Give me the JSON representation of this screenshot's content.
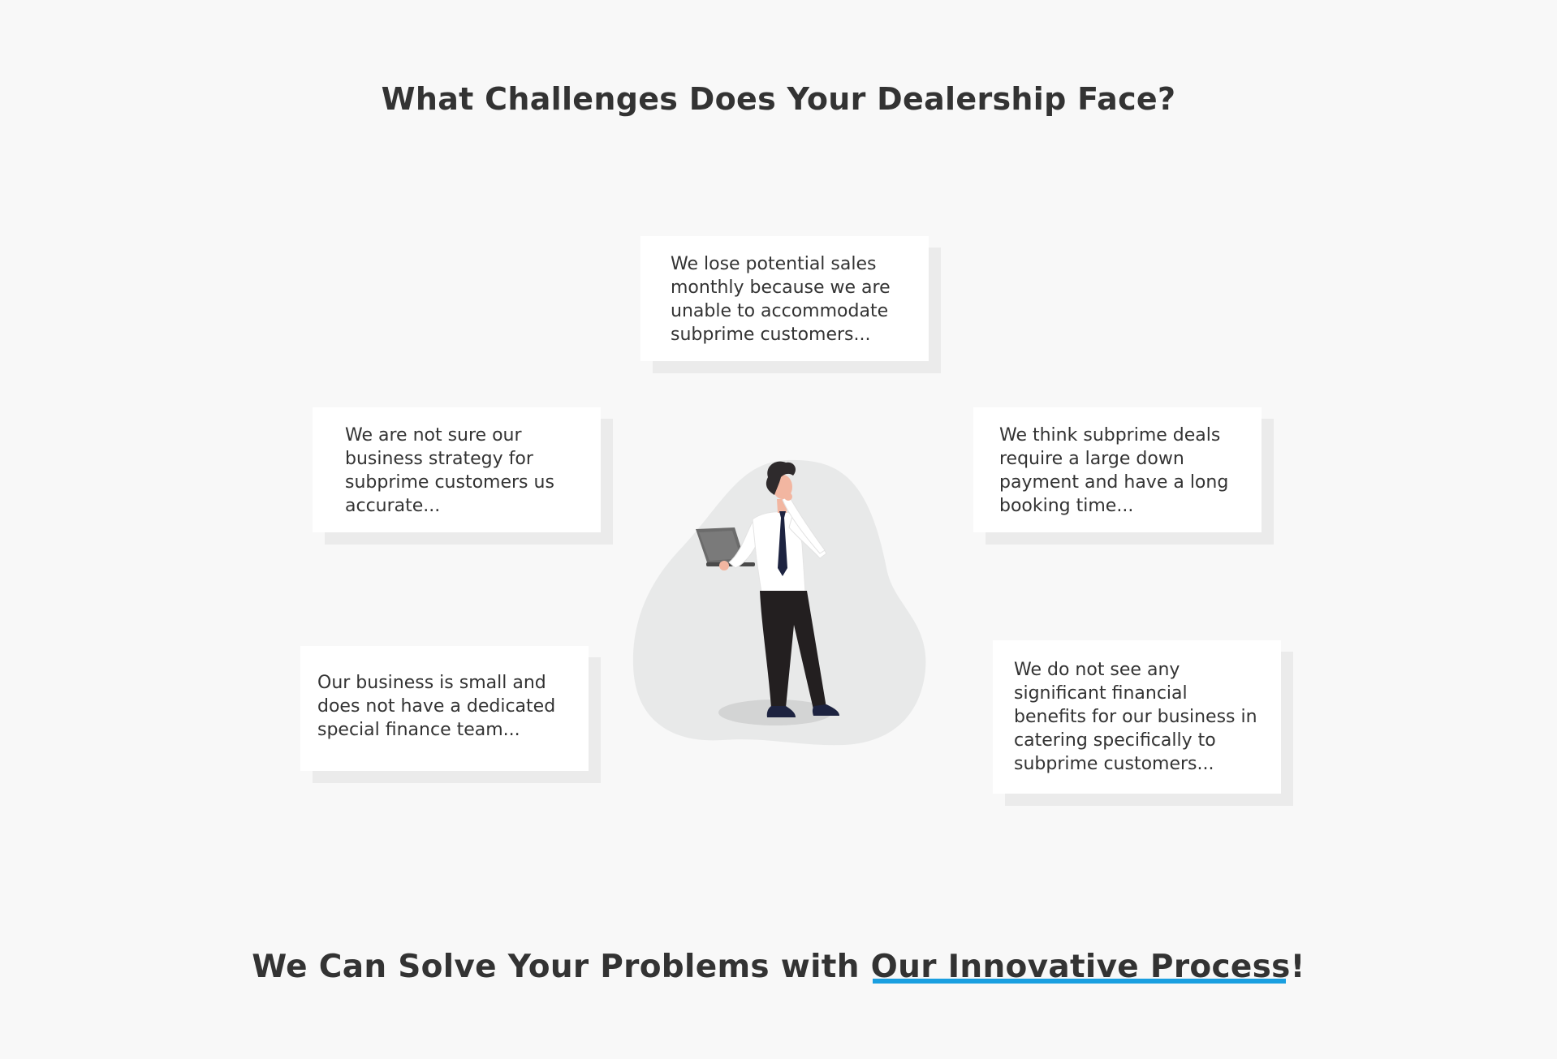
{
  "header": {
    "title": "What Challenges Does Your Dealership Face?"
  },
  "challenges": [
    {
      "text": "We lose potential sales monthly because we are unable to accommodate subprime customers..."
    },
    {
      "text": "We are not sure our business strategy for subprime customers us accurate..."
    },
    {
      "text": "We think subprime deals require a large down payment and have a long booking time..."
    },
    {
      "text": "Our business is small and does not have a dedicated special finance team..."
    },
    {
      "text": "We do not see any significant financial benefits for our business in catering specifically to subprime customers..."
    }
  ],
  "footer": {
    "title_lead": "We Can Solve Your Problems with ",
    "title_highlight": "Our Innovative Process",
    "title_end": "!"
  },
  "colors": {
    "background": "#f8f8f8",
    "text": "#333333",
    "card": "#ffffff",
    "card_shadow": "#ebebeb",
    "accent_underline": "#1a9fe0"
  },
  "icons": {
    "illustration": "thinking-businessman-with-laptop-illustration"
  }
}
